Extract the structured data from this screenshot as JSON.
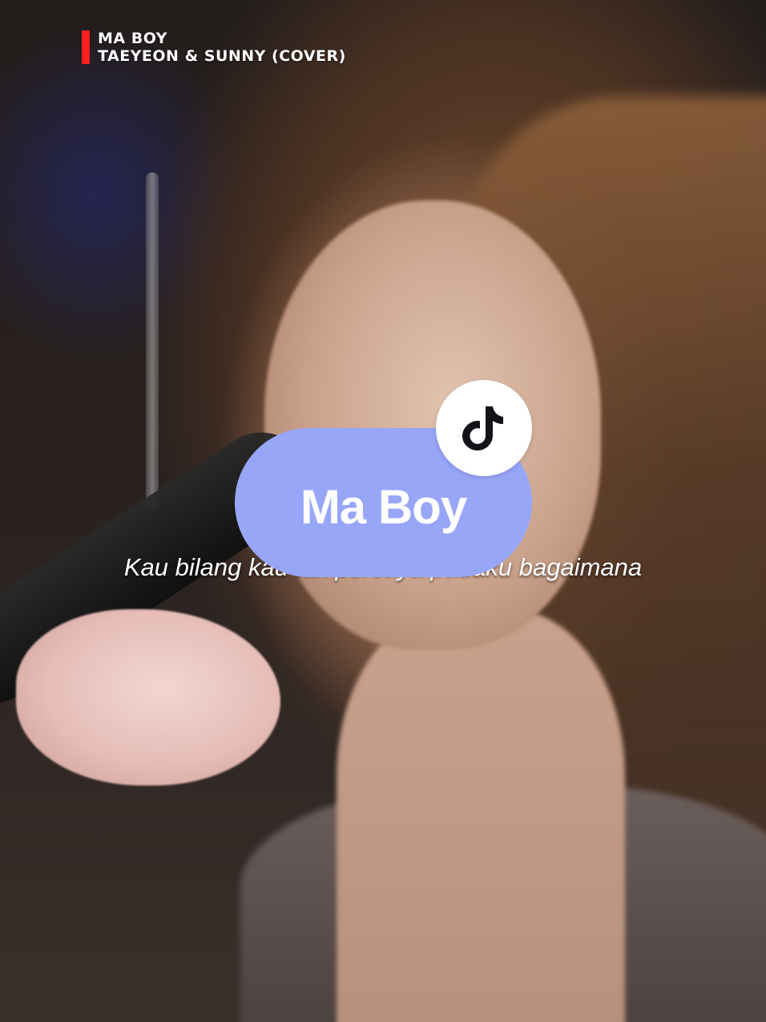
{
  "header": {
    "song_title": "MA BOY",
    "artist_line": "TAEYEON & SUNNY (COVER)",
    "accent_color": "#ff1f1f"
  },
  "overlay": {
    "pill_label": "Ma Boy",
    "pill_color": "#98a6f8",
    "badge_icon": "tiktok-logo-icon"
  },
  "subtitle": {
    "text": "Kau bilang kau tak percaya padaku bagaimana"
  }
}
